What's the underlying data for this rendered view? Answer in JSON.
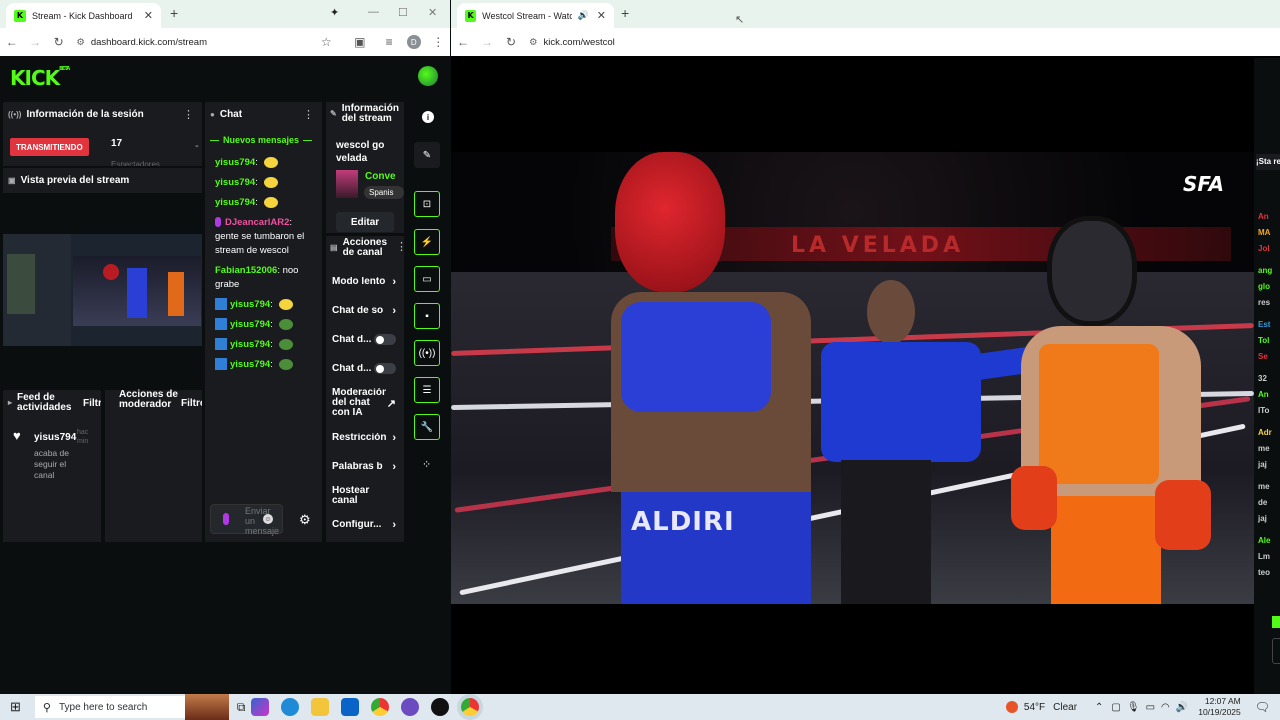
{
  "left_window": {
    "tab_title": "Stream - Kick Dashboard",
    "url": "dashboard.kick.com/stream",
    "profile_initial": "D",
    "logo": "KICK",
    "logo_sup": "BETA"
  },
  "session": {
    "title": "Información de la sesión",
    "status": "TRANSMITIENDO",
    "viewers": "17",
    "subtext": "Espectadores",
    "dash": "-"
  },
  "preview": {
    "title": "Vista previa del stream"
  },
  "chat": {
    "title": "Chat",
    "new_messages": "Nuevos mensajes",
    "messages": [
      {
        "user": "yisus794",
        "text": "",
        "emote": "smile"
      },
      {
        "user": "yisus794",
        "text": "",
        "emote": "smile"
      },
      {
        "user": "yisus794",
        "text": "",
        "emote": "smile"
      },
      {
        "user": "DJeancarlAR2",
        "text": "gente se tumbaron el stream de wescol"
      },
      {
        "user": "Fabian152006",
        "text": "noo grabe"
      },
      {
        "user": "yisus794",
        "text": "",
        "emote": "smile"
      },
      {
        "user": "yisus794",
        "text": "",
        "emote": "frog"
      },
      {
        "user": "yisus794",
        "text": "",
        "emote": "frog"
      },
      {
        "user": "yisus794",
        "text": "",
        "emote": "frog"
      }
    ],
    "input_placeholder": "Enviar un mensaje"
  },
  "stream_info": {
    "title": "Información del stream",
    "stream_title": "wescol go velada",
    "category": "Conve",
    "language": "Spanis",
    "edit": "Editar"
  },
  "channel_actions": {
    "title": "Acciones de canal",
    "items": [
      {
        "label": "Modo lento",
        "control": "chevron"
      },
      {
        "label": "Chat de so",
        "control": "chevron"
      },
      {
        "label": "Chat d...",
        "control": "toggle"
      },
      {
        "label": "Chat d...",
        "control": "toggle"
      },
      {
        "label": "Moderación del chat con IA",
        "control": "external"
      },
      {
        "label": "Restricción",
        "control": "chevron"
      },
      {
        "label": "Palabras b",
        "control": "chevron"
      },
      {
        "label": "Hostear canal",
        "control": "none"
      },
      {
        "label": "Configur...",
        "control": "chevron"
      }
    ]
  },
  "activity_feed": {
    "title": "Feed de actividades",
    "filter": "Filtro",
    "user": "yisus794",
    "time": "hac min",
    "event": "acaba de seguir el canal"
  },
  "mod_actions": {
    "title": "Acciones de moderador",
    "filter": "Filtro"
  },
  "right_window": {
    "tab_title": "Westcol Stream - Watch Liv",
    "url": "kick.com/westcol",
    "watermark": "SFA",
    "banner_text": "LA VELADA",
    "shorts_text_left": "ALDIRI"
  },
  "side_chat_snippets": [
    "An",
    "MA",
    "Jol",
    "ang",
    "glo",
    "res",
    "Est",
    "Tol",
    "Se",
    "32",
    "An",
    "ITo",
    "Adr",
    "me",
    "jaj",
    "me",
    "de",
    "jaj",
    "Ale",
    "Lm",
    "teo"
  ],
  "side_notice": "¡Sta reg",
  "taskbar": {
    "search_placeholder": "Type here to search",
    "temperature": "54°F",
    "weather": "Clear",
    "time": "12:07 AM",
    "date": "10/19/2025"
  },
  "colors": {
    "kick_green": "#53fc18",
    "live_red": "#e0343e",
    "panel": "#191b1f"
  }
}
